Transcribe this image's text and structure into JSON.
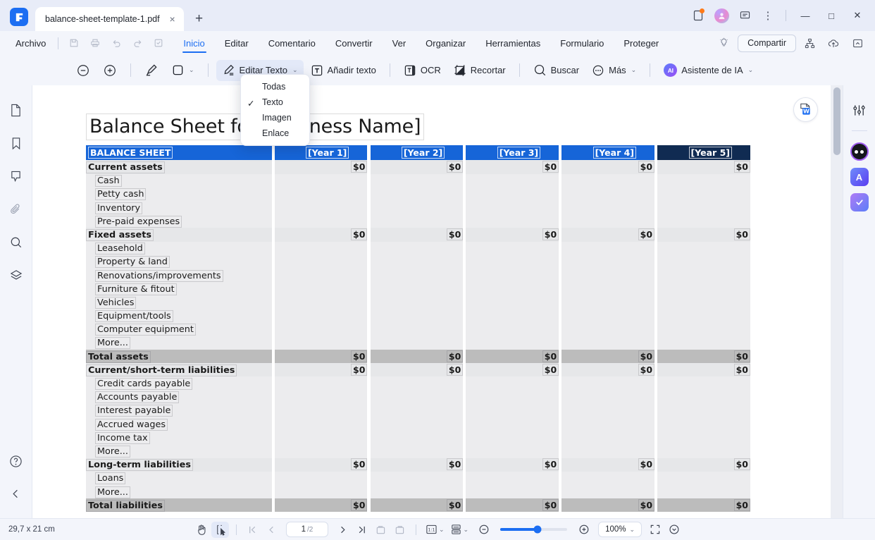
{
  "titlebar": {
    "tab_title": "balance-sheet-template-1.pdf",
    "close_glyph": "×",
    "new_tab_glyph": "+",
    "minimize_glyph": "—",
    "maximize_glyph": "□",
    "close_window_glyph": "✕",
    "more_glyph": "⋮"
  },
  "menubar": {
    "file_label": "Archivo",
    "items": [
      {
        "label": "Inicio",
        "active": true
      },
      {
        "label": "Editar",
        "active": false
      },
      {
        "label": "Comentario",
        "active": false
      },
      {
        "label": "Convertir",
        "active": false
      },
      {
        "label": "Ver",
        "active": false
      },
      {
        "label": "Organizar",
        "active": false
      },
      {
        "label": "Herramientas",
        "active": false
      },
      {
        "label": "Formulario",
        "active": false
      },
      {
        "label": "Proteger",
        "active": false
      }
    ],
    "share_label": "Compartir"
  },
  "toolbar": {
    "edit_text_label": "Editar Texto",
    "add_text_label": "Añadir texto",
    "ocr_label": "OCR",
    "crop_label": "Recortar",
    "search_label": "Buscar",
    "more_label": "Más",
    "ai_label": "Asistente de IA",
    "ai_badge": "AI",
    "chevron": "⌄"
  },
  "dropdown": {
    "items": [
      {
        "label": "Todas",
        "checked": false
      },
      {
        "label": "Texto",
        "checked": true
      },
      {
        "label": "Imagen",
        "checked": false
      },
      {
        "label": "Enlace",
        "checked": false
      }
    ],
    "check_glyph": "✓"
  },
  "document": {
    "title": "Balance Sheet for [Business Name]",
    "header": {
      "label": "BALANCE SHEET",
      "years": [
        "[Year 1]",
        "[Year 2]",
        "[Year 3]",
        "[Year 4]",
        "[Year 5]"
      ]
    },
    "rows": [
      {
        "label": "Current assets",
        "style": "section",
        "indent": false,
        "values": [
          "$0",
          "$0",
          "$0",
          "$0",
          "$0"
        ]
      },
      {
        "label": "Cash",
        "style": "item",
        "indent": true,
        "values": [
          "",
          "",
          "",
          "",
          ""
        ]
      },
      {
        "label": "Petty cash",
        "style": "item",
        "indent": true,
        "values": [
          "",
          "",
          "",
          "",
          ""
        ]
      },
      {
        "label": "Inventory",
        "style": "item",
        "indent": true,
        "values": [
          "",
          "",
          "",
          "",
          ""
        ]
      },
      {
        "label": "Pre-paid expenses",
        "style": "item",
        "indent": true,
        "values": [
          "",
          "",
          "",
          "",
          ""
        ]
      },
      {
        "label": "Fixed assets",
        "style": "section",
        "indent": false,
        "values": [
          "$0",
          "$0",
          "$0",
          "$0",
          "$0"
        ]
      },
      {
        "label": "Leasehold",
        "style": "item",
        "indent": true,
        "values": [
          "",
          "",
          "",
          "",
          ""
        ]
      },
      {
        "label": "Property & land",
        "style": "item",
        "indent": true,
        "values": [
          "",
          "",
          "",
          "",
          ""
        ]
      },
      {
        "label": "Renovations/improvements",
        "style": "item",
        "indent": true,
        "values": [
          "",
          "",
          "",
          "",
          ""
        ]
      },
      {
        "label": "Furniture & fitout",
        "style": "item",
        "indent": true,
        "values": [
          "",
          "",
          "",
          "",
          ""
        ]
      },
      {
        "label": "Vehicles",
        "style": "item",
        "indent": true,
        "values": [
          "",
          "",
          "",
          "",
          ""
        ]
      },
      {
        "label": "Equipment/tools",
        "style": "item",
        "indent": true,
        "values": [
          "",
          "",
          "",
          "",
          ""
        ]
      },
      {
        "label": "Computer equipment",
        "style": "item",
        "indent": true,
        "values": [
          "",
          "",
          "",
          "",
          ""
        ]
      },
      {
        "label": "More...",
        "style": "item",
        "indent": true,
        "values": [
          "",
          "",
          "",
          "",
          ""
        ]
      },
      {
        "label": "Total assets",
        "style": "total",
        "indent": false,
        "values": [
          "$0",
          "$0",
          "$0",
          "$0",
          "$0"
        ]
      },
      {
        "label": "Current/short-term liabilities",
        "style": "section",
        "indent": false,
        "values": [
          "$0",
          "$0",
          "$0",
          "$0",
          "$0"
        ]
      },
      {
        "label": "Credit cards payable",
        "style": "item",
        "indent": true,
        "values": [
          "",
          "",
          "",
          "",
          ""
        ]
      },
      {
        "label": "Accounts payable",
        "style": "item",
        "indent": true,
        "values": [
          "",
          "",
          "",
          "",
          ""
        ]
      },
      {
        "label": "Interest payable",
        "style": "item",
        "indent": true,
        "values": [
          "",
          "",
          "",
          "",
          ""
        ]
      },
      {
        "label": "Accrued wages",
        "style": "item",
        "indent": true,
        "values": [
          "",
          "",
          "",
          "",
          ""
        ]
      },
      {
        "label": "Income tax",
        "style": "item",
        "indent": true,
        "values": [
          "",
          "",
          "",
          "",
          ""
        ]
      },
      {
        "label": "More...",
        "style": "item",
        "indent": true,
        "values": [
          "",
          "",
          "",
          "",
          ""
        ]
      },
      {
        "label": "Long-term liabilities",
        "style": "section",
        "indent": false,
        "values": [
          "$0",
          "$0",
          "$0",
          "$0",
          "$0"
        ]
      },
      {
        "label": "Loans",
        "style": "item",
        "indent": true,
        "values": [
          "",
          "",
          "",
          "",
          ""
        ]
      },
      {
        "label": "More...",
        "style": "item",
        "indent": true,
        "values": [
          "",
          "",
          "",
          "",
          ""
        ]
      },
      {
        "label": "Total liabilities",
        "style": "total",
        "indent": false,
        "values": [
          "$0",
          "$0",
          "$0",
          "$0",
          "$0"
        ]
      }
    ]
  },
  "statusbar": {
    "dimensions": "29,7 x 21 cm",
    "page_current": "1",
    "page_total": "/2",
    "zoom_level": "100%",
    "chevron": "⌄"
  },
  "colors": {
    "accent": "#1c6ef2",
    "header_blue": "#1665d8",
    "header_navy": "#102b52",
    "row_shade": "#e6e7e9",
    "total_shade": "#bcbcbc"
  }
}
